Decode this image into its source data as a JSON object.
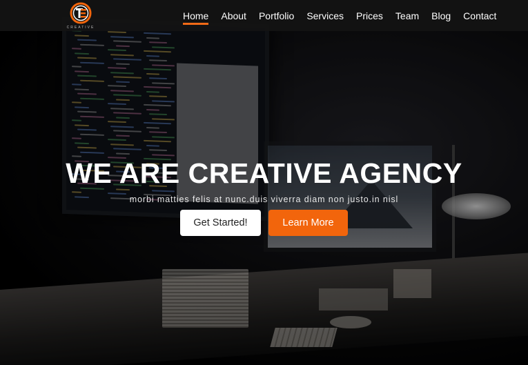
{
  "brand": {
    "logo_letter": "E",
    "logo_word": "CREATIVE",
    "accent_color": "#f2650c"
  },
  "nav": {
    "items": [
      {
        "label": "Home",
        "active": true
      },
      {
        "label": "About",
        "active": false
      },
      {
        "label": "Portfolio",
        "active": false
      },
      {
        "label": "Services",
        "active": false
      },
      {
        "label": "Prices",
        "active": false
      },
      {
        "label": "Team",
        "active": false
      },
      {
        "label": "Blog",
        "active": false
      },
      {
        "label": "Contact",
        "active": false
      }
    ]
  },
  "hero": {
    "title": "WE ARE CREATIVE AGENCY",
    "subtitle": "morbi matties felis at nunc.duis viverra diam non justo.in nisl",
    "primary_button": "Get Started!",
    "secondary_button": "Learn More"
  }
}
